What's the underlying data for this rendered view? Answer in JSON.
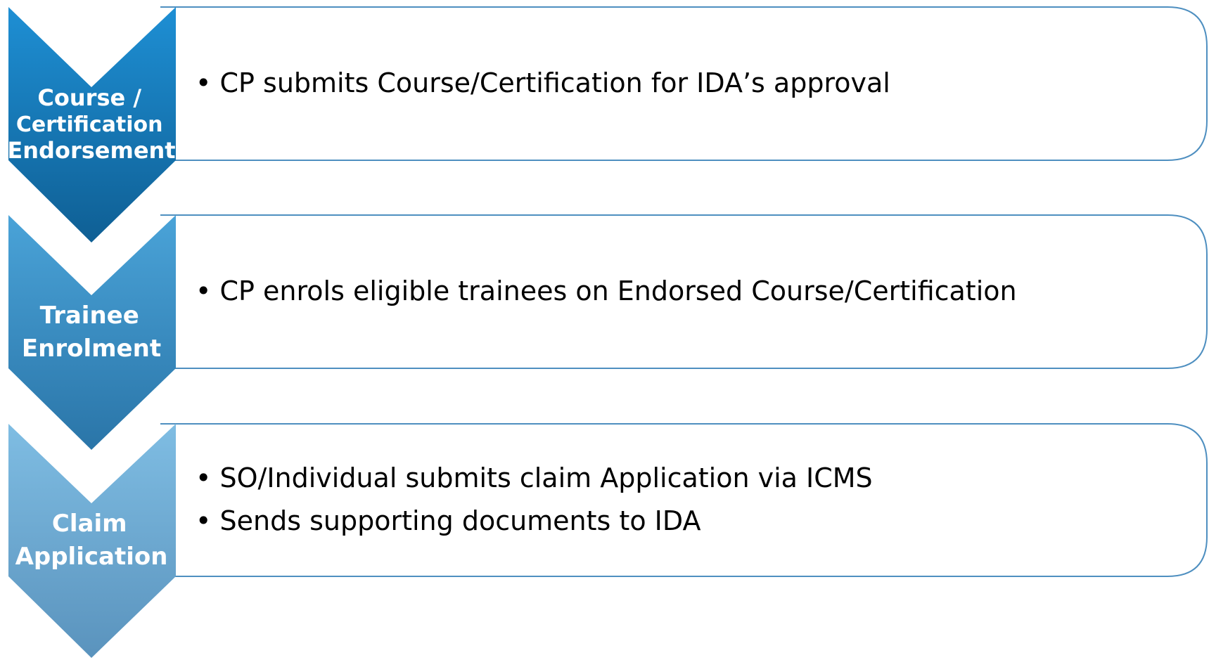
{
  "colors": {
    "chevron_1_top": "#1e8fd4",
    "chevron_1_bottom": "#0f5f94",
    "chevron_2_top": "#4aa3d8",
    "chevron_2_bottom": "#2a75a8",
    "chevron_3_top": "#7fbde3",
    "chevron_3_bottom": "#5a93bd",
    "box_border": "#4e8fc0",
    "text": "#000000",
    "label_text": "#ffffff"
  },
  "stages": [
    {
      "label_lines": [
        "Course /",
        "Certification",
        "Endorsement"
      ],
      "bullets": [
        "CP submits Course/Certification for IDA’s approval"
      ]
    },
    {
      "label_lines": [
        "Trainee",
        "Enrolment"
      ],
      "bullets": [
        "CP enrols eligible trainees on Endorsed Course/Certification"
      ]
    },
    {
      "label_lines": [
        "Claim",
        "Application"
      ],
      "bullets": [
        "SO/Individual submits claim Application via ICMS",
        "Sends supporting documents to IDA"
      ]
    }
  ]
}
